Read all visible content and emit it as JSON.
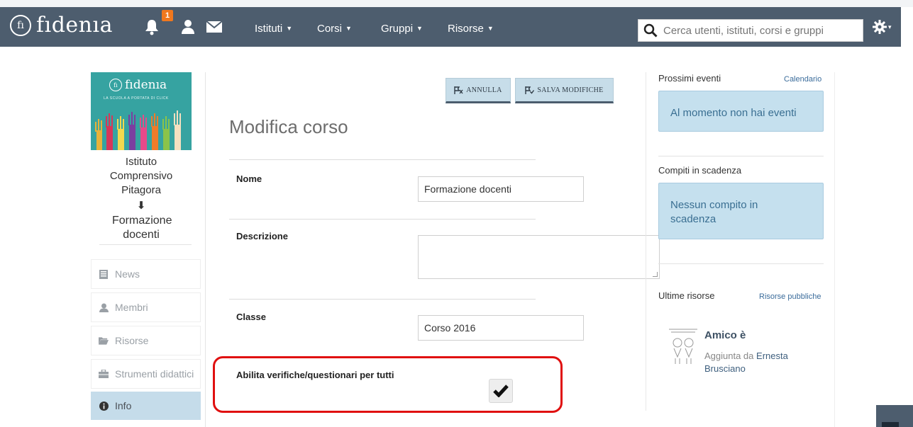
{
  "header": {
    "brand": "fıdenıa",
    "brand_mark": "fı",
    "notification_count": "1",
    "menu": [
      {
        "label": "Istituti"
      },
      {
        "label": "Corsi"
      },
      {
        "label": "Gruppi"
      },
      {
        "label": "Risorse"
      }
    ],
    "search_placeholder": "Cerca utenti, istituti, corsi e gruppi",
    "colors": {
      "navbar": "#4d5d6e",
      "badge": "#f0781e"
    }
  },
  "sidebar": {
    "logo_brand": "fıdenıa",
    "logo_mark": "fı",
    "logo_tagline": "LA SCUOLA A PORTATA DI CLICK",
    "institute": "Istituto Comprensivo Pitagora",
    "arrow": "⬇",
    "course": "Formazione docenti",
    "items": [
      {
        "label": "News",
        "icon": "news-icon"
      },
      {
        "label": "Membri",
        "icon": "user-icon"
      },
      {
        "label": "Risorse",
        "icon": "folder-icon"
      },
      {
        "label": "Strumenti didattici",
        "icon": "briefcase-icon"
      },
      {
        "label": "Info",
        "icon": "info-icon",
        "active": true
      }
    ]
  },
  "main": {
    "cancel_label": "ANNULLA",
    "save_label": "SALVA MODIFICHE",
    "title": "Modifica corso",
    "fields": {
      "name_label": "Nome",
      "name_value": "Formazione docenti",
      "description_label": "Descrizione",
      "description_value": "",
      "class_label": "Classe",
      "class_value": "Corso 2016",
      "quiz_label": "Abilita verifiche/questionari per tutti",
      "quiz_checked": true
    }
  },
  "right": {
    "events_title": "Prossimi eventi",
    "events_link": "Calendario",
    "events_empty": "Al momento non hai eventi",
    "tasks_title": "Compiti in scadenza",
    "tasks_empty": "Nessun compito in scadenza",
    "resources_title": "Ultime risorse",
    "resources_link": "Risorse pubbliche",
    "resource": {
      "title": "Amico è",
      "added_by_prefix": "Aggiunta da",
      "author": "Ernesta Brusciano"
    }
  }
}
